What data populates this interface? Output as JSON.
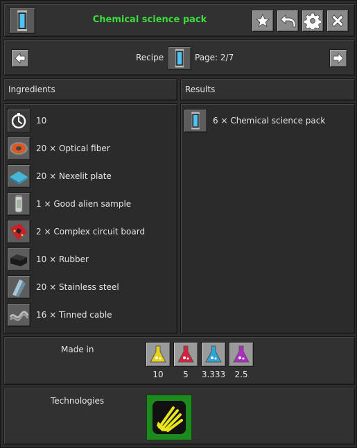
{
  "header": {
    "title": "Chemical science pack",
    "title_color": "#3bdc3b",
    "item_icon": "chemical-science-pack-icon",
    "buttons": [
      {
        "name": "favorite-button",
        "icon": "star-icon"
      },
      {
        "name": "back-button",
        "icon": "undo-arrow-icon"
      },
      {
        "name": "settings-button",
        "icon": "gear-icon"
      },
      {
        "name": "close-button",
        "icon": "close-icon"
      }
    ]
  },
  "nav": {
    "recipe_label": "Recipe",
    "page_label": "Page: 2/7",
    "prev_icon": "arrow-left-icon",
    "next_icon": "arrow-right-icon"
  },
  "ingredients": {
    "header": "Ingredients",
    "items": [
      {
        "icon": "time-icon",
        "text": "10"
      },
      {
        "icon": "optical-fiber-icon",
        "text": "20 × Optical fiber"
      },
      {
        "icon": "nexelit-plate-icon",
        "text": "20 × Nexelit plate"
      },
      {
        "icon": "good-alien-sample-icon",
        "text": "1 × Good alien sample"
      },
      {
        "icon": "complex-circuit-board-icon",
        "text": "2 × Complex circuit board"
      },
      {
        "icon": "rubber-icon",
        "text": "10 × Rubber"
      },
      {
        "icon": "stainless-steel-icon",
        "text": "20 × Stainless steel"
      },
      {
        "icon": "tinned-cable-icon",
        "text": "16 × Tinned cable"
      }
    ]
  },
  "results": {
    "header": "Results",
    "items": [
      {
        "icon": "chemical-science-pack-icon",
        "text": "6 × Chemical science pack"
      }
    ]
  },
  "made_in": {
    "label": "Made in",
    "machines": [
      {
        "icon": "research-center-yellow-icon",
        "value": "10",
        "color": "#e8d21a"
      },
      {
        "icon": "research-center-red-icon",
        "value": "5",
        "color": "#d8203c"
      },
      {
        "icon": "research-center-blue-icon",
        "value": "3.333",
        "color": "#2aa6d8"
      },
      {
        "icon": "research-center-purple-icon",
        "value": "2.5",
        "color": "#b02ac8"
      }
    ]
  },
  "technologies": {
    "label": "Technologies",
    "tech_icon": "fiber-optics-technology-icon",
    "color": "#e8e61a"
  }
}
